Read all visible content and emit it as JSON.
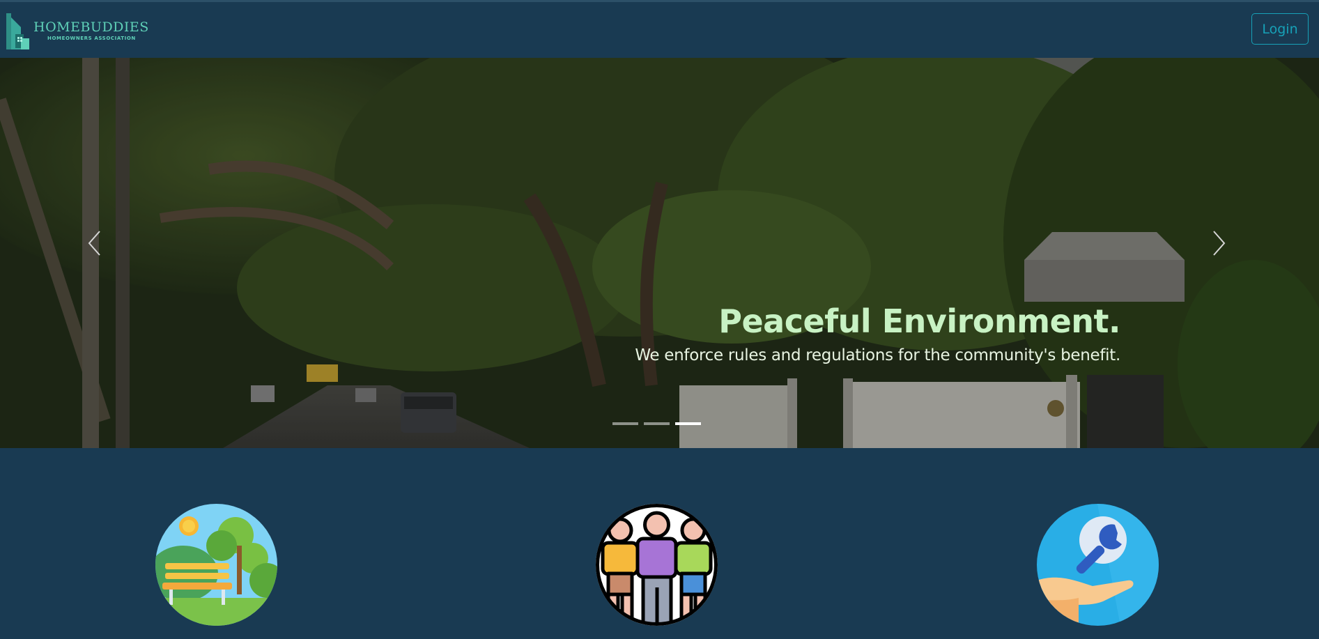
{
  "navbar": {
    "brand_name": "HOMEBUDDIES",
    "brand_sub": "HOMEOWNERS ASSOCIATION",
    "login_label": "Login",
    "accent": "#17a2b8",
    "logo_color": "#5fd1b8"
  },
  "carousel": {
    "title": "Peaceful Environment.",
    "text": "We enforce rules and regulations for the community's benefit.",
    "prev_icon": "chevron-left-icon",
    "next_icon": "chevron-right-icon",
    "slide_count": 3,
    "active_slide": 3
  },
  "features": {
    "icons": [
      "park-bench-icon",
      "community-people-icon",
      "maintenance-service-icon"
    ]
  },
  "colors": {
    "background": "#193a52",
    "caption_title": "#c8f2c4"
  }
}
